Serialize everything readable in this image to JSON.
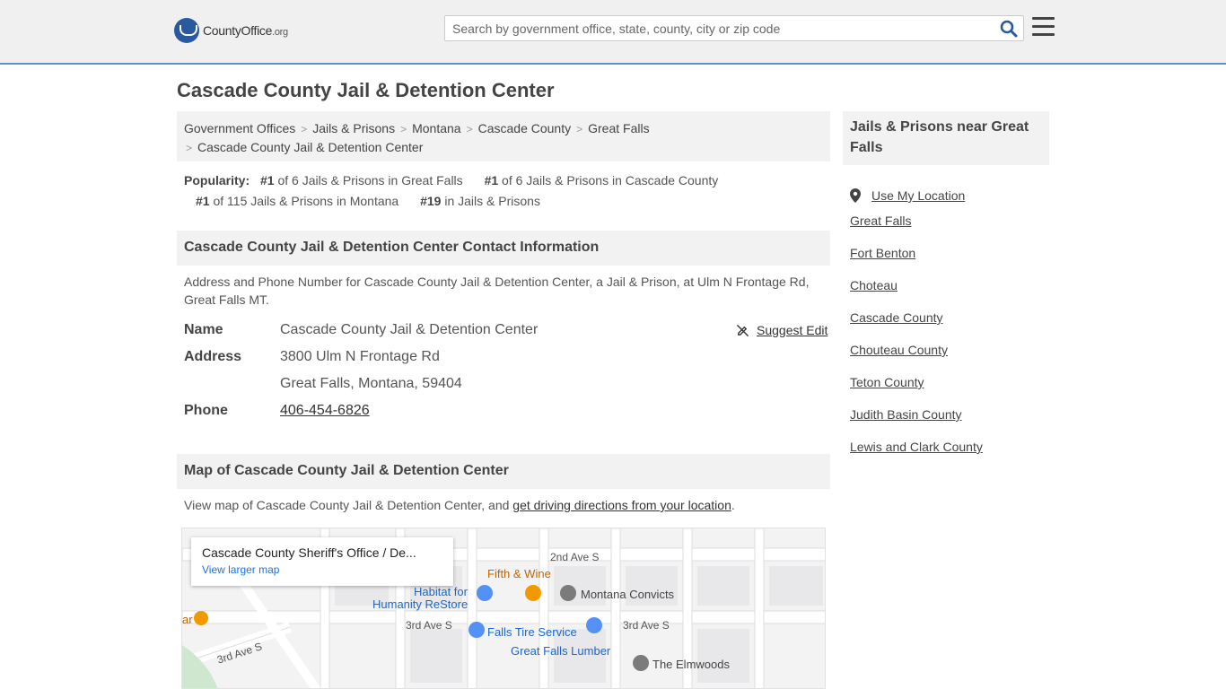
{
  "header": {
    "logo_main": "CountyOffice",
    "logo_ext": ".org",
    "search_placeholder": "Search by government office, state, county, city or zip code"
  },
  "page": {
    "title": "Cascade County Jail & Detention Center"
  },
  "breadcrumb": [
    "Government Offices",
    "Jails & Prisons",
    "Montana",
    "Cascade County",
    "Great Falls",
    "Cascade County Jail & Detention Center"
  ],
  "popularity": {
    "label": "Popularity:",
    "items": [
      {
        "rank": "#1",
        "text": "of 6 Jails & Prisons in Great Falls"
      },
      {
        "rank": "#1",
        "text": "of 6 Jails & Prisons in Cascade County"
      },
      {
        "rank": "#1",
        "text": "of 115 Jails & Prisons in Montana"
      },
      {
        "rank": "#19",
        "text": "in Jails & Prisons"
      }
    ]
  },
  "contact": {
    "heading": "Cascade County Jail & Detention Center Contact Information",
    "description": "Address and Phone Number for Cascade County Jail & Detention Center, a Jail & Prison, at Ulm N Frontage Rd, Great Falls MT.",
    "name_label": "Name",
    "name_value": "Cascade County Jail & Detention Center",
    "address_label": "Address",
    "address_line1": "3800 Ulm N Frontage Rd",
    "address_line2": "Great Falls, Montana, 59404",
    "phone_label": "Phone",
    "phone_value": "406-454-6826",
    "suggest_edit": "Suggest Edit"
  },
  "map_section": {
    "heading": "Map of Cascade County Jail & Detention Center",
    "desc_prefix": "View map of Cascade County Jail & Detention Center, and ",
    "desc_link": "get driving directions from your location",
    "desc_suffix": ".",
    "card_title": "Cascade County Sheriff's Office / De...",
    "card_link": "View larger map",
    "labels": {
      "street1": "2nd Ave S",
      "street2": "3rd Ave S",
      "street3": "3rd Ave S",
      "street4": "3rd Ave S",
      "poi1": "Fifth & Wine",
      "poi2": "Habitat for",
      "poi2b": "Humanity ReStore",
      "poi3": "Montana Convicts",
      "poi4": "Falls Tire Service",
      "poi5": "Great Falls Lumber",
      "poi6": "The Elmwoods",
      "poi7": "ar"
    }
  },
  "sidebar": {
    "heading": "Jails & Prisons near Great Falls",
    "use_location": "Use My Location",
    "links": [
      "Great Falls",
      "Fort Benton",
      "Choteau",
      "Cascade County",
      "Chouteau County",
      "Teton County",
      "Judith Basin County",
      "Lewis and Clark County"
    ]
  }
}
